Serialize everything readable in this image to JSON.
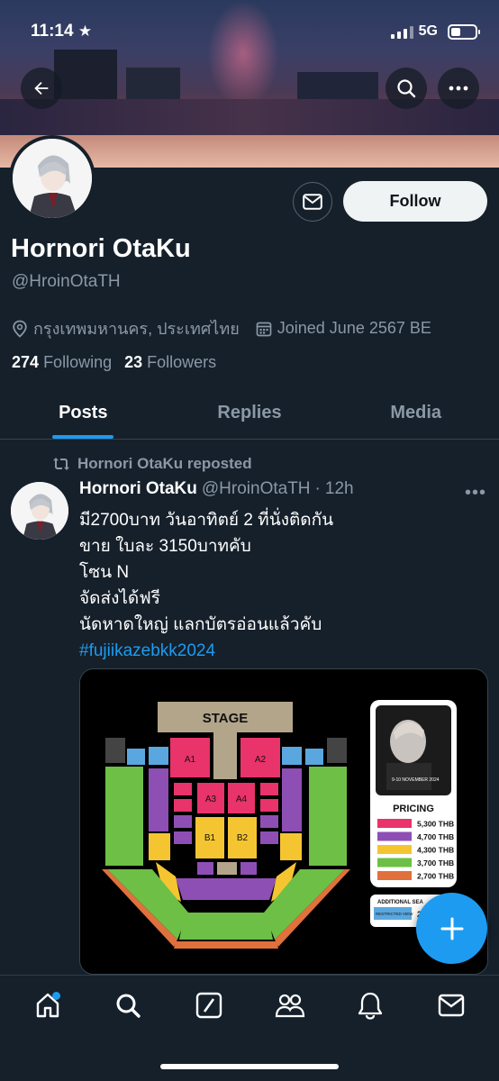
{
  "status_bar": {
    "time": "11:14",
    "network": "5G"
  },
  "profile": {
    "display_name": "Hornori OtaKu",
    "handle": "@HroinOtaTH",
    "location": "กรุงเทพมหานคร, ประเทศไทย",
    "joined": "Joined June 2567 BE",
    "following_count": "274",
    "following_label": "Following",
    "followers_count": "23",
    "followers_label": "Followers",
    "follow_label": "Follow"
  },
  "tabs": [
    {
      "label": "Posts",
      "active": true
    },
    {
      "label": "Replies",
      "active": false
    },
    {
      "label": "Media",
      "active": false
    }
  ],
  "post": {
    "repost_label": "Hornori OtaKu reposted",
    "author_name": "Hornori OtaKu",
    "author_handle": "@HroinOtaTH",
    "separator": "·",
    "time": "12h",
    "text": "มี2700บาท วันอาทิตย์ 2 ที่นั่งติดกัน\nขาย ใบละ 3150บาทคับ\nโซน N\n จัดส่งได้ฟรี\nนัดหาดใหญ่ แลกบัตรอ่อนแล้วคับ",
    "hashtag": "#fujiikazebkk2024",
    "media": {
      "stage_label": "STAGE",
      "poster_date": "9-10 NOVEMBER 2024",
      "pricing_title": "PRICING",
      "prices": [
        {
          "amount": "5,300",
          "unit": "THB",
          "color": "#e8336b"
        },
        {
          "amount": "4,700",
          "unit": "THB",
          "color": "#8e4fb5"
        },
        {
          "amount": "4,300",
          "unit": "THB",
          "color": "#f5c531"
        },
        {
          "amount": "3,700",
          "unit": "THB",
          "color": "#6dbf45"
        },
        {
          "amount": "2,700",
          "unit": "THB",
          "color": "#e0703c"
        }
      ],
      "additional_label": "ADDITIONAL SEA",
      "restricted_label": "RESTRICTED VIEW",
      "restricted_price": "2",
      "emoji": "😊"
    }
  },
  "icons": {
    "back": "back-arrow-icon",
    "search": "search-icon",
    "more": "more-icon",
    "message": "mail-icon",
    "compose": "plus-icon"
  },
  "colors": {
    "accent": "#1d9bf0",
    "background": "#15202b"
  }
}
